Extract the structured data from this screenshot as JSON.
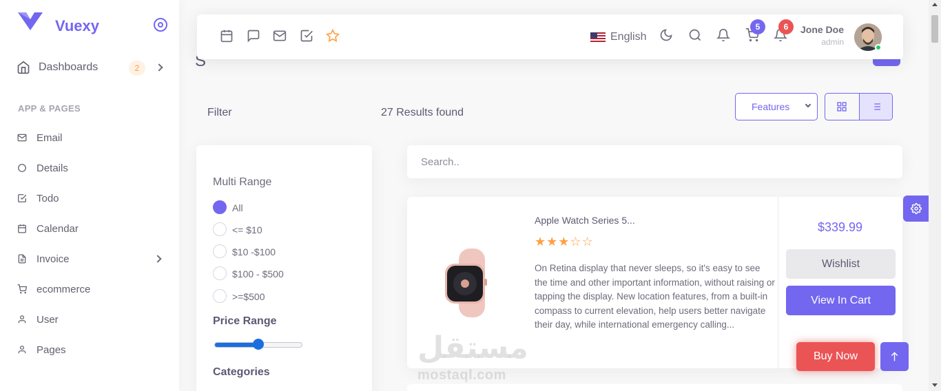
{
  "sidebar": {
    "brand": "Vuexy",
    "dashboards": {
      "label": "Dashboards",
      "badge": "2"
    },
    "section_header": "APP & PAGES",
    "items": [
      {
        "label": "Email",
        "icon": "mail-icon"
      },
      {
        "label": "Details",
        "icon": "circle-icon"
      },
      {
        "label": "Todo",
        "icon": "check-square-icon"
      },
      {
        "label": "Calendar",
        "icon": "calendar-icon"
      },
      {
        "label": "Invoice",
        "icon": "file-text-icon"
      },
      {
        "label": "ecommerce",
        "icon": "shopping-cart-icon"
      },
      {
        "label": "User",
        "icon": "user-icon"
      },
      {
        "label": "Pages",
        "icon": "user-icon"
      }
    ]
  },
  "header": {
    "language": "English",
    "cart_count": "5",
    "notification_count": "6",
    "user_name": "Jone Doe",
    "user_role": "admin",
    "colors": {
      "accent": "#7367f0",
      "danger": "#ea5455",
      "warning": "#ff9f43",
      "success": "#28c76f"
    }
  },
  "toolbar": {
    "filter_label": "Filter",
    "results": "27 Results found",
    "sort_selected": "Features"
  },
  "filters": {
    "multi_range_title": "Multi Range",
    "ranges": [
      "All",
      "<= $10",
      "$10 -$100",
      "$100 - $500",
      ">=$500"
    ],
    "selected_range": "All",
    "price_range_title": "Price Range",
    "price_range_value": 0.5,
    "categories_title": "Categories"
  },
  "search": {
    "placeholder": "Search.."
  },
  "product": {
    "name": "Apple Watch Series 5...",
    "rating": 3,
    "max_rating": 5,
    "description": "On Retina display that never sleeps, so it's easy to see the time and other important information, without raising or tapping the display. New location features, from a built-in compass to current elevation, help users better navigate their day, while international emergency calling...",
    "price": "$339.99",
    "wishlist_label": "Wishlist",
    "cart_label": "View In Cart"
  },
  "buy_now_label": "Buy Now",
  "watermark": {
    "arabic": "مستقل",
    "latin": "mostaql.com"
  }
}
